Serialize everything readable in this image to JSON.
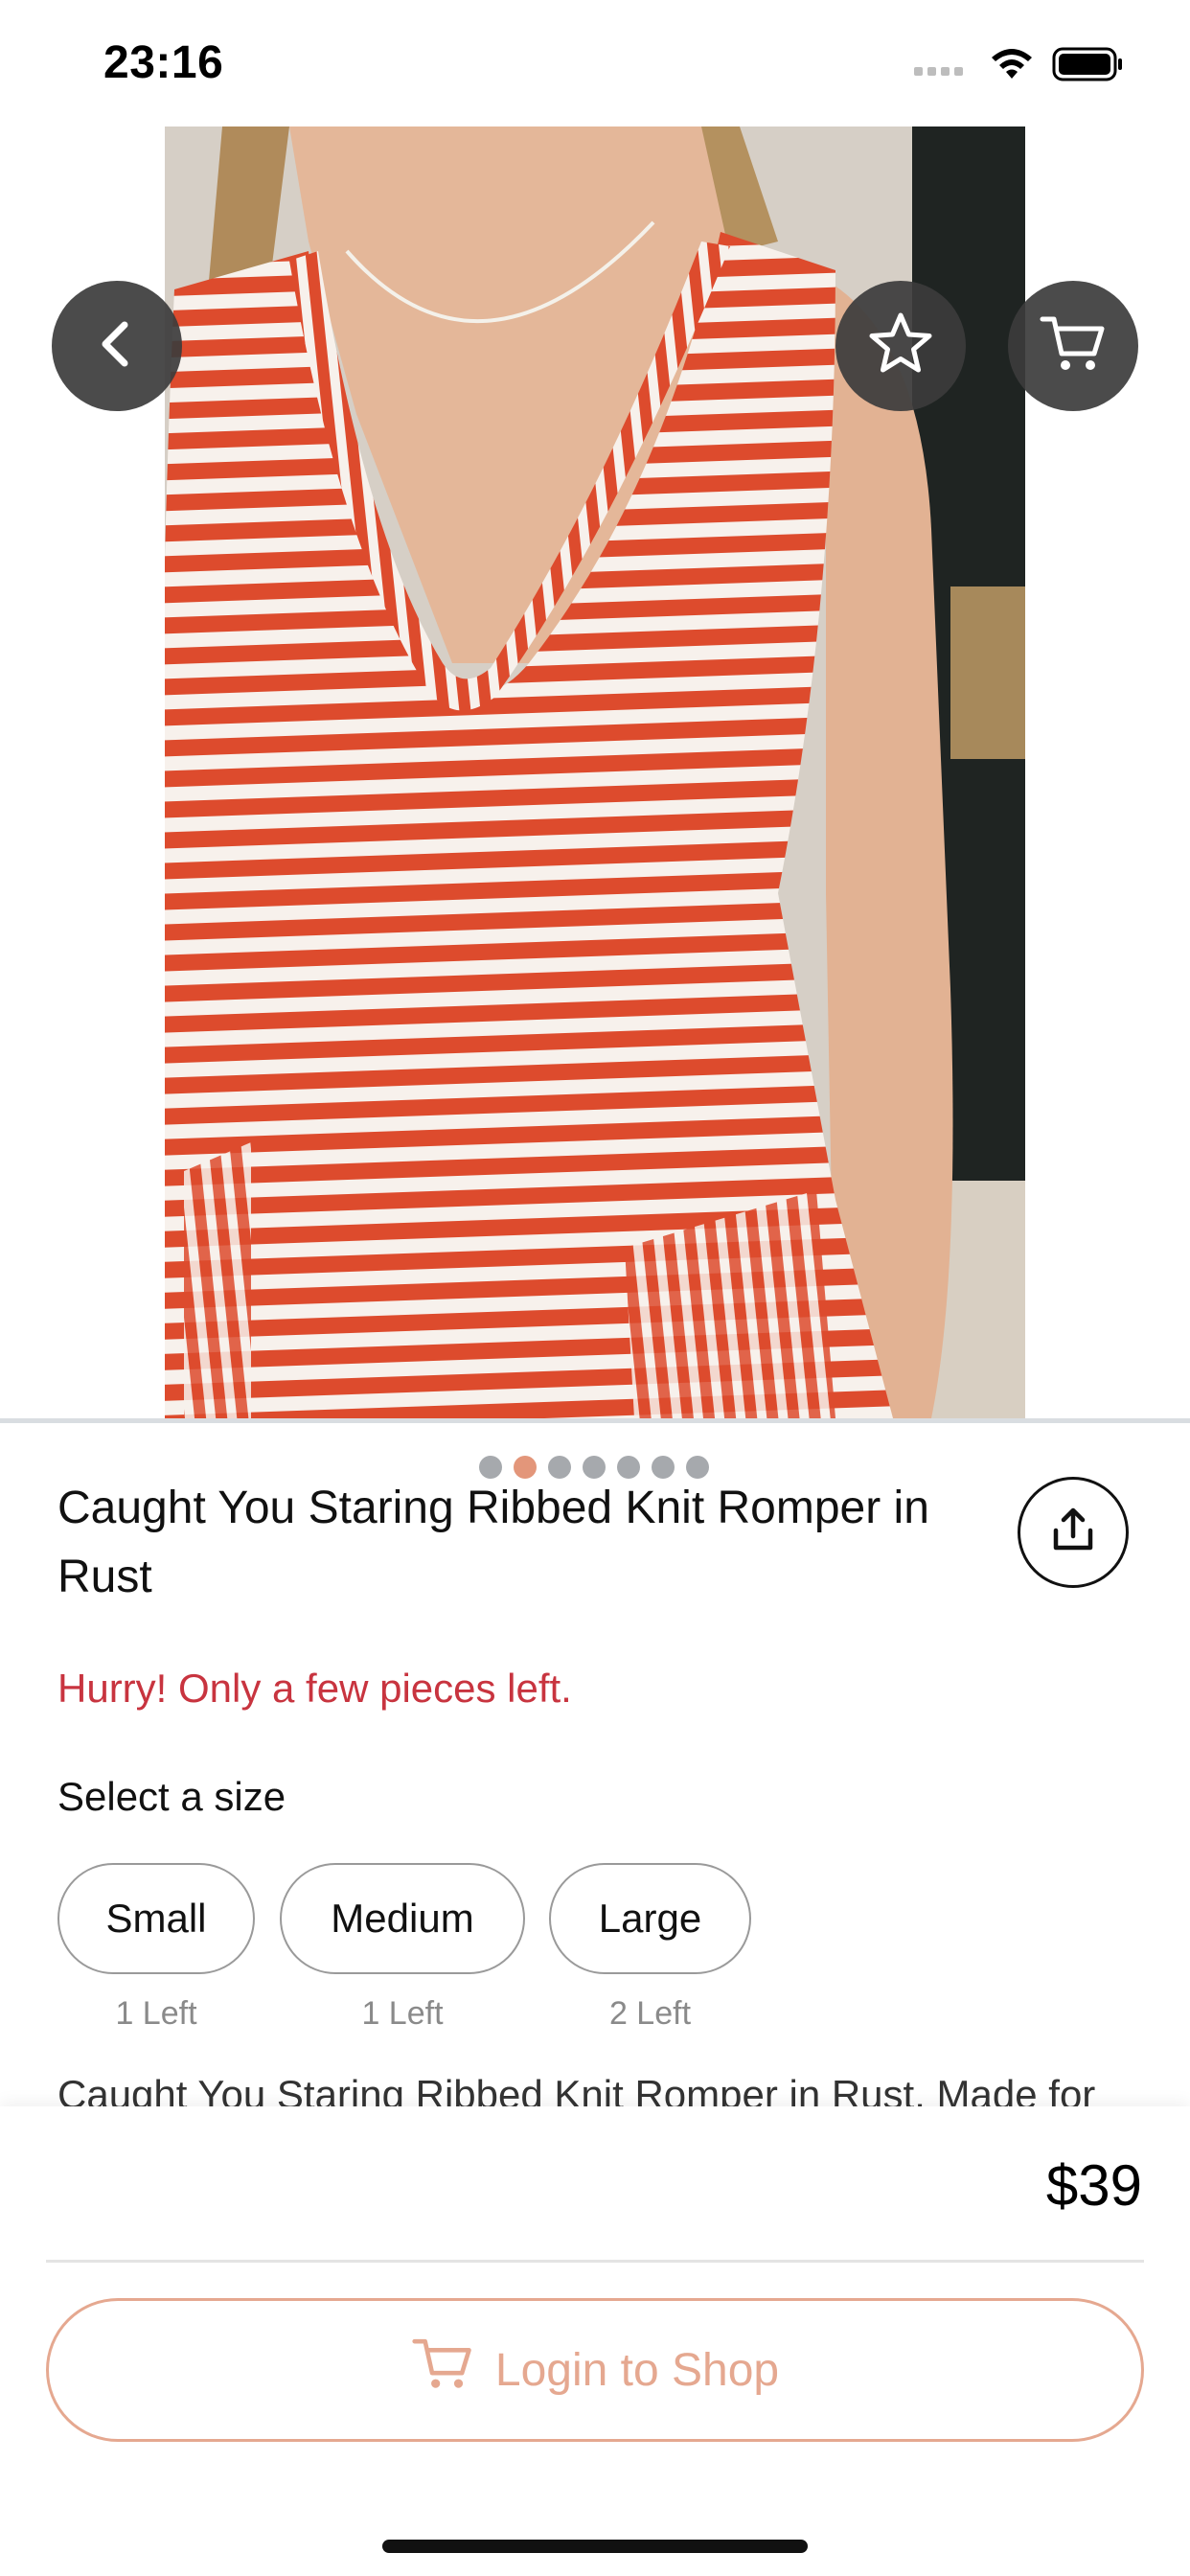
{
  "status_bar": {
    "time": "23:16",
    "icons": [
      "cellular-signal-icon",
      "wifi-icon",
      "battery-icon"
    ]
  },
  "hero": {
    "image_subject": "red and white striped sleeveless ribbed knit romper",
    "carousel_total": 7,
    "carousel_active_index": 1,
    "buttons": {
      "back_icon": "chevron-left-icon",
      "favorite_icon": "star-icon",
      "cart_icon": "cart-icon"
    }
  },
  "product": {
    "title": "Caught You Staring Ribbed Knit Romper in Rust",
    "stock_warning": "Hurry! Only a few pieces left.",
    "size_heading": "Select a size",
    "sizes": [
      {
        "label": "Small",
        "stock": "1 Left"
      },
      {
        "label": "Medium",
        "stock": "1 Left"
      },
      {
        "label": "Large",
        "stock": "2 Left"
      }
    ],
    "description": "Caught You Staring Ribbed Knit Romper in Rust. Made for",
    "share_icon": "share-icon"
  },
  "checkout": {
    "price": "$39",
    "login_button_label": "Login to Shop",
    "login_button_icon": "cart-icon"
  },
  "colors": {
    "accent": "#E5A890",
    "warning": "#C8343F",
    "carousel_active": "#E3967A",
    "carousel_inactive": "#A6A9AD",
    "overlay_button": "#3C3C3C"
  }
}
